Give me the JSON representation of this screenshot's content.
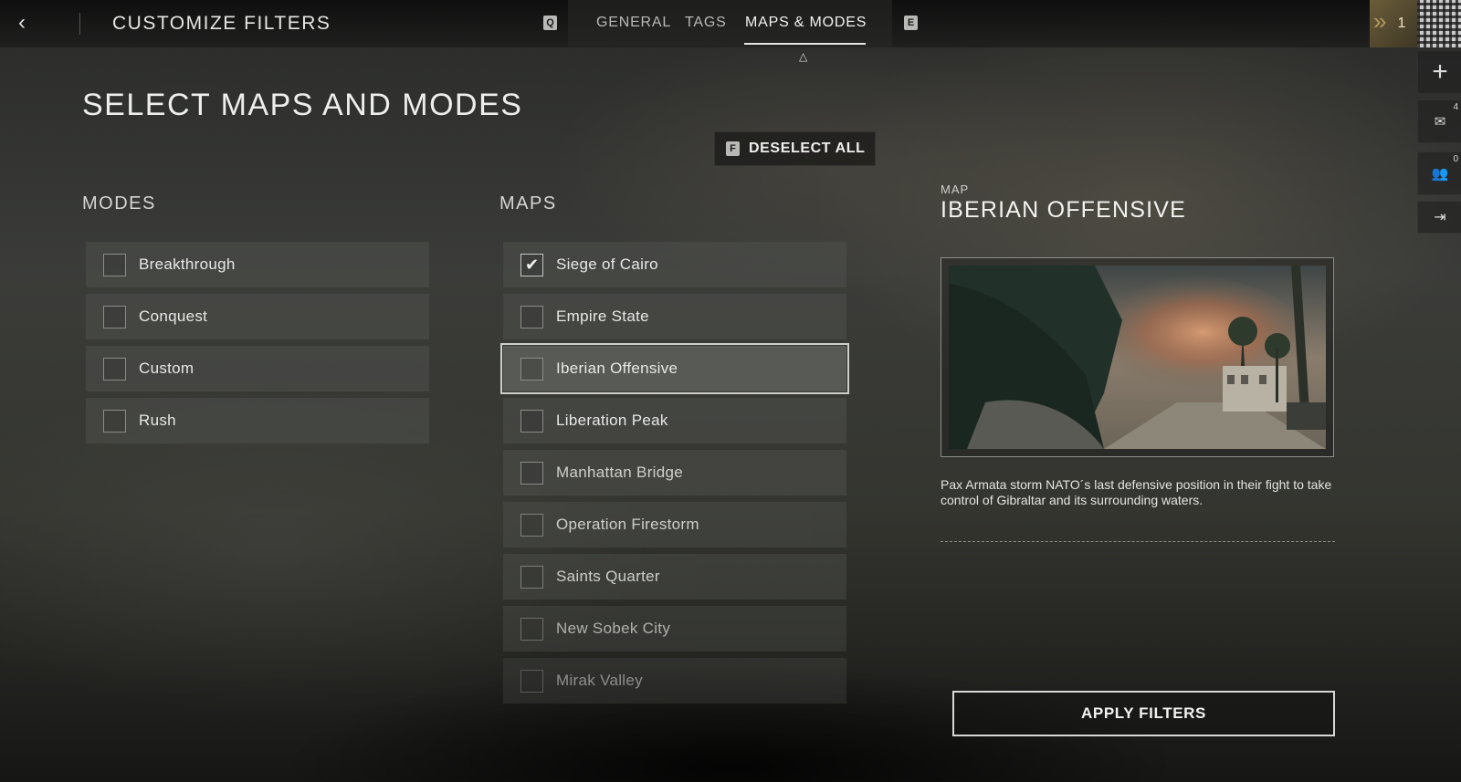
{
  "header": {
    "title": "CUSTOMIZE FILTERS",
    "prev_key": "Q",
    "next_key": "E",
    "tabs": [
      {
        "label": "GENERAL",
        "active": false
      },
      {
        "label": "TAGS",
        "active": false
      },
      {
        "label": "MAPS & MODES",
        "active": true
      }
    ],
    "rank": "1"
  },
  "sidebar": {
    "messages_count": "4",
    "friends_count": "0"
  },
  "main": {
    "title": "SELECT MAPS AND MODES",
    "deselect": {
      "key": "F",
      "label": "DESELECT ALL"
    },
    "modes": {
      "heading": "MODES",
      "items": [
        {
          "label": "Breakthrough",
          "checked": false
        },
        {
          "label": "Conquest",
          "checked": false
        },
        {
          "label": "Custom",
          "checked": false
        },
        {
          "label": "Rush",
          "checked": false
        }
      ]
    },
    "maps": {
      "heading": "MAPS",
      "items": [
        {
          "label": "Siege of Cairo",
          "checked": true
        },
        {
          "label": "Empire State",
          "checked": false
        },
        {
          "label": "Iberian Offensive",
          "checked": false,
          "focused": true
        },
        {
          "label": "Liberation Peak",
          "checked": false
        },
        {
          "label": "Manhattan Bridge",
          "checked": false
        },
        {
          "label": "Operation Firestorm",
          "checked": false
        },
        {
          "label": "Saints Quarter",
          "checked": false
        },
        {
          "label": "New Sobek City",
          "checked": false
        },
        {
          "label": "Mirak Valley",
          "checked": false
        }
      ]
    }
  },
  "detail": {
    "kicker": "MAP",
    "title": "IBERIAN OFFENSIVE",
    "description": "Pax Armata storm NATO´s last defensive position in their fight to take control of Gibraltar and its surrounding waters."
  },
  "footer": {
    "apply_label": "APPLY FILTERS"
  },
  "colors": {
    "accent": "#d8d8d6",
    "row_bg": "#4e504c",
    "rank_gold": "#b49a5c"
  }
}
